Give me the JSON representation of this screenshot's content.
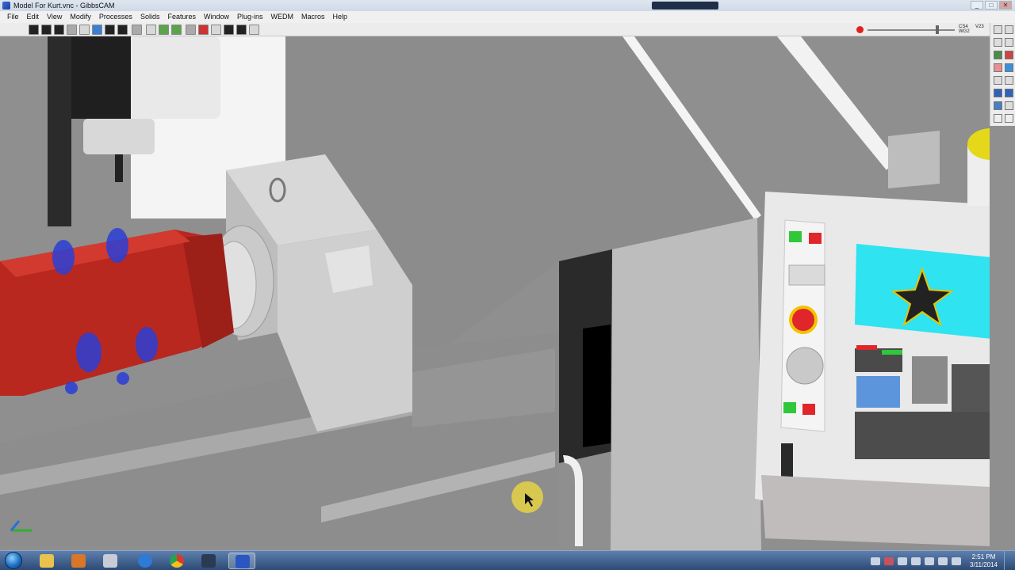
{
  "window": {
    "title": "Model For Kurt.vnc - GibbsCAM"
  },
  "menu": {
    "items": [
      {
        "id": "file",
        "label": "File"
      },
      {
        "id": "edit",
        "label": "Edit"
      },
      {
        "id": "view",
        "label": "View"
      },
      {
        "id": "modify",
        "label": "Modify"
      },
      {
        "id": "processes",
        "label": "Processes"
      },
      {
        "id": "solids",
        "label": "Solids"
      },
      {
        "id": "features",
        "label": "Features"
      },
      {
        "id": "window",
        "label": "Window"
      },
      {
        "id": "plugins",
        "label": "Plug-ins"
      },
      {
        "id": "wedm",
        "label": "WEDM"
      },
      {
        "id": "macros",
        "label": "Macros"
      },
      {
        "id": "help",
        "label": "Help"
      }
    ]
  },
  "toolbar": {
    "readout_a": "CS4",
    "readout_b": "WG2",
    "readout_c": "V23"
  },
  "taskbar": {
    "time": "2:51 PM",
    "date": "3/11/2014"
  },
  "colors": {
    "part_red": "#b8281f",
    "coolant_blue": "#2a3fd6",
    "screen_cyan": "#2fe3f0",
    "machine_gray": "#8f8f8f",
    "panel_white": "#e9e9e9"
  }
}
